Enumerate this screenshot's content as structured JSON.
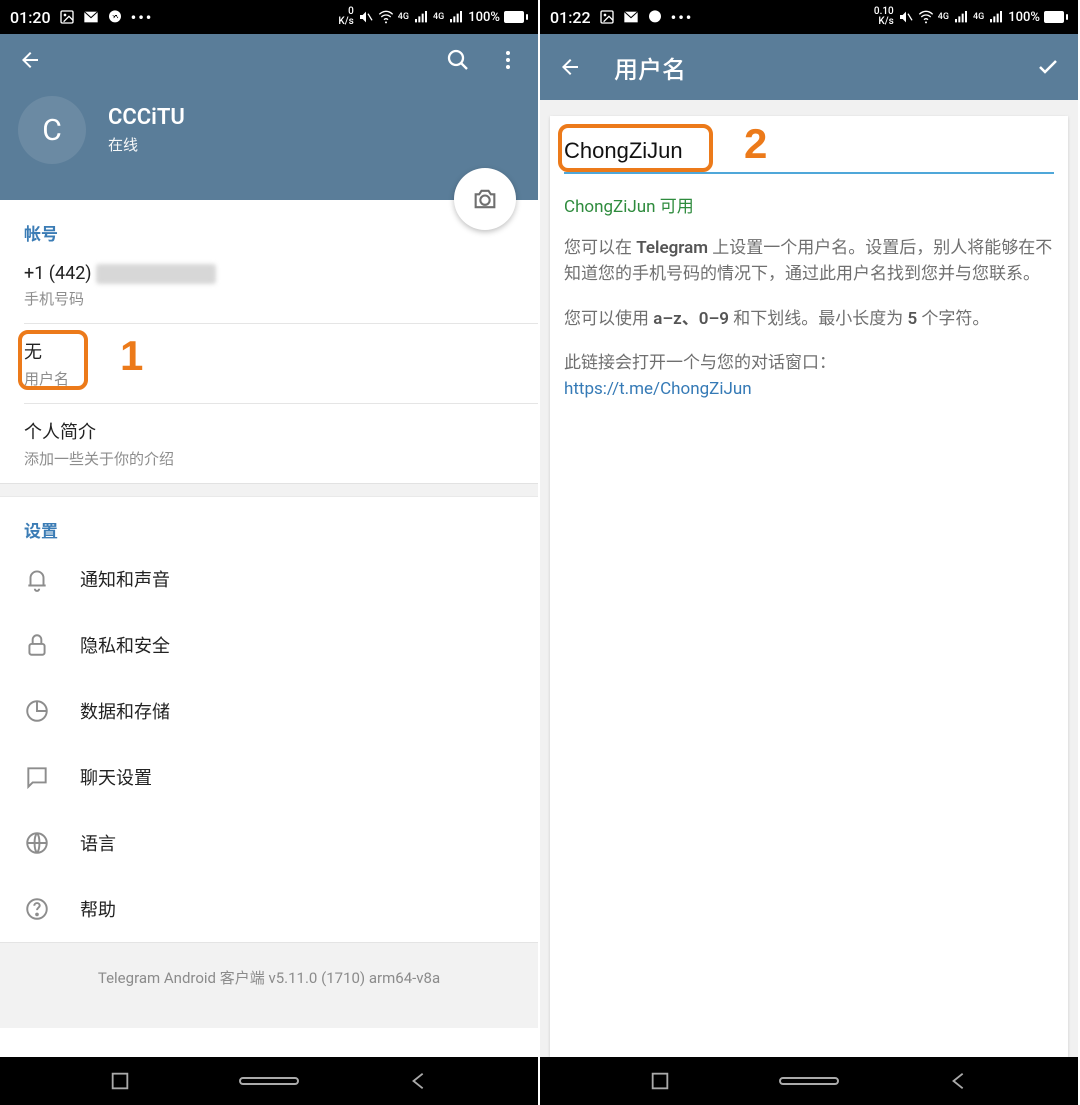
{
  "left": {
    "status": {
      "time": "01:20",
      "net": "0\nK/s",
      "battery": "100%"
    },
    "profile": {
      "avatar_letter": "C",
      "name": "CCCiTU",
      "status": "在线"
    },
    "account": {
      "section": "帐号",
      "phone_prefix": "+1 (442)",
      "phone_label": "手机号码",
      "username_value": "无",
      "username_label": "用户名",
      "bio_title": "个人简介",
      "bio_sub": "添加一些关于你的介绍"
    },
    "settings": {
      "section": "设置",
      "items": [
        {
          "label": "通知和声音"
        },
        {
          "label": "隐私和安全"
        },
        {
          "label": "数据和存储"
        },
        {
          "label": "聊天设置"
        },
        {
          "label": "语言"
        },
        {
          "label": "帮助"
        }
      ]
    },
    "footer": "Telegram Android 客户端 v5.11.0 (1710) arm64-v8a",
    "annotation": "1"
  },
  "right": {
    "status": {
      "time": "01:22",
      "net": "0.10\nK/s",
      "battery": "100%"
    },
    "title": "用户名",
    "input_value": "ChongZiJun",
    "available": "ChongZiJun 可用",
    "desc1_a": "您可以在 ",
    "desc1_b": "Telegram",
    "desc1_c": " 上设置一个用户名。设置后，别人将能够在不知道您的手机号码的情况下，通过此用户名找到您并与您联系。",
    "desc2_a": "您可以使用 ",
    "desc2_b": "a–z、0–9",
    "desc2_c": " 和下划线。最小长度为 ",
    "desc2_d": "5",
    "desc2_e": " 个字符。",
    "desc3": "此链接会打开一个与您的对话窗口：",
    "link": "https://t.me/ChongZiJun",
    "annotation": "2"
  }
}
